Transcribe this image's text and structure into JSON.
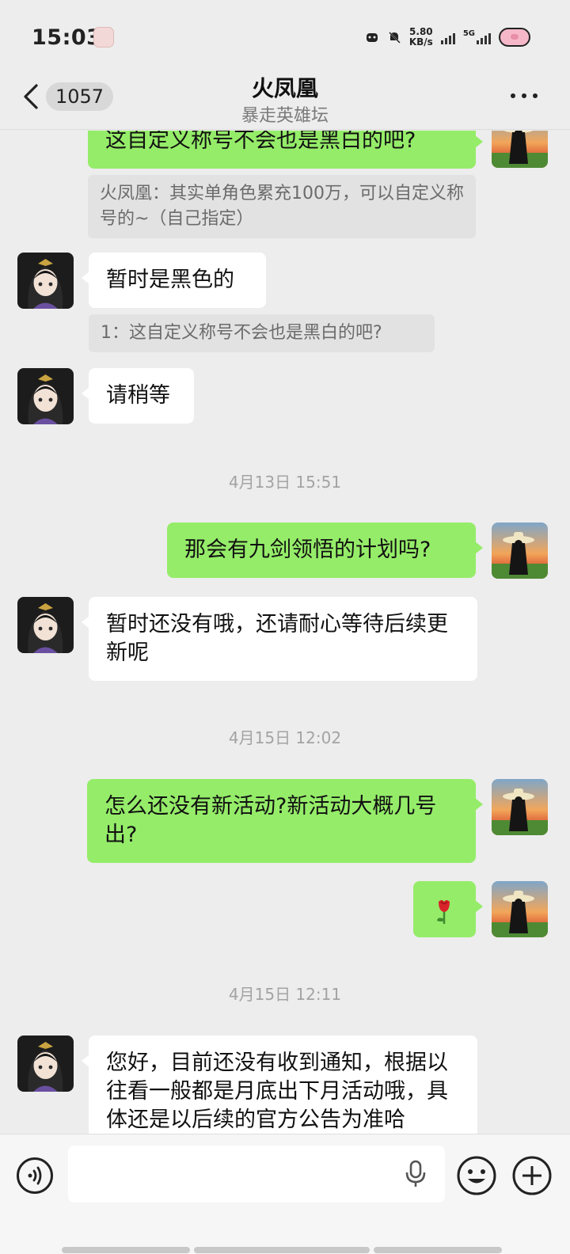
{
  "status_bar": {
    "time": "15:03",
    "net_speed_value": "5.80",
    "net_speed_unit": "KB/s",
    "network_label": "5G"
  },
  "header": {
    "title": "火凤凰",
    "subtitle": "暴走英雄坛",
    "unread_count": "1057"
  },
  "messages": [
    {
      "from": "me",
      "text": "这自定义称号不会也是黑白的吧?",
      "quote": "火凤凰：其实单角色累充100万，可以自定义称号的~（自己指定）"
    },
    {
      "from": "other",
      "text": "暂时是黑色的",
      "quote": "1：这自定义称号不会也是黑白的吧?"
    },
    {
      "from": "other",
      "text": "请稍等"
    },
    {
      "timestamp": "4月13日 15:51"
    },
    {
      "from": "me",
      "text": "那会有九剑领悟的计划吗?"
    },
    {
      "from": "other",
      "text": "暂时还没有哦，还请耐心等待后续更新呢"
    },
    {
      "timestamp": "4月15日 12:02"
    },
    {
      "from": "me",
      "text": "怎么还没有新活动?新活动大概几号出?"
    },
    {
      "from": "me",
      "emoji": "rose"
    },
    {
      "timestamp": "4月15日 12:11"
    },
    {
      "from": "other",
      "text": "您好，目前还没有收到通知，根据以往看一般都是月底出下月活动哦，具体还是以后续的官方公告为准哈"
    }
  ],
  "input": {
    "placeholder": "",
    "value": ""
  },
  "icons": {
    "back": "chevron-left-icon",
    "more": "more-dots-icon",
    "voice": "voice-icon",
    "mic": "mic-icon",
    "emoji": "emoji-icon",
    "plus": "plus-icon"
  },
  "colors": {
    "my_bubble": "#95ec69",
    "other_bubble": "#ffffff",
    "background": "#ededed"
  }
}
